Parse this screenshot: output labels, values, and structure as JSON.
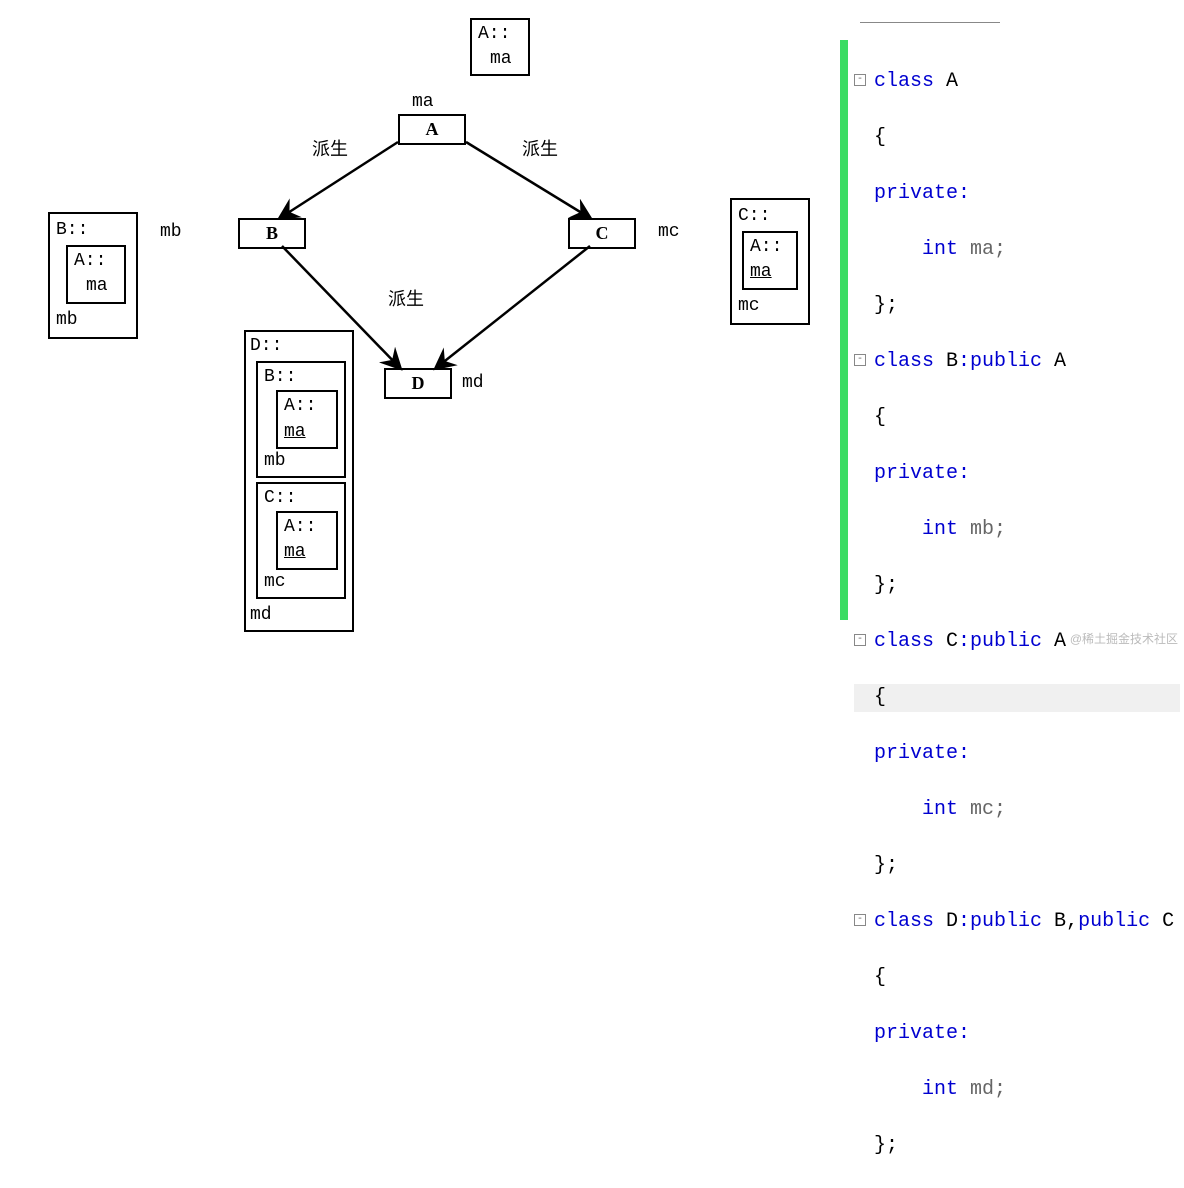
{
  "tiny_box": {
    "line1": "A::",
    "line2": "ma"
  },
  "node_a": "A",
  "node_b": "B",
  "node_c": "C",
  "node_d": "D",
  "label_ma_top": "ma",
  "label_mb": "mb",
  "label_mc": "mc",
  "label_md": "md",
  "label_derive_ab": "派生",
  "label_derive_ac": "派生",
  "label_derive_bd": "派生",
  "boxB": {
    "title": "B::",
    "inner": {
      "line1": "A::",
      "line2": "ma"
    },
    "tail": "mb"
  },
  "boxC": {
    "title": "C::",
    "inner": {
      "line1": "A::",
      "line2": "ma"
    },
    "tail": "mc"
  },
  "boxD": {
    "title": "D::",
    "blkB": {
      "title": "B::",
      "inner": {
        "line1": "A::",
        "line2": "ma"
      },
      "tail": "mb"
    },
    "blkC": {
      "title": "C::",
      "inner": {
        "line1": "A::",
        "line2": "ma"
      },
      "tail": "mc"
    },
    "tail": "md"
  },
  "code": {
    "l1a": "class ",
    "l1b": "A",
    "l2": "{",
    "l3": "private:",
    "l4a": "    int ",
    "l4b": "ma;",
    "l5": "};",
    "l6a": "class ",
    "l6b": "B",
    "l6c": ":public ",
    "l6d": "A",
    "l7": "{",
    "l8": "private:",
    "l9a": "    int ",
    "l9b": "mb;",
    "l10": "};",
    "l11a": "class ",
    "l11b": "C",
    "l11c": ":public ",
    "l11d": "A",
    "l12": "{",
    "l13": "private:",
    "l14a": "    int ",
    "l14b": "mc;",
    "l15": "};",
    "l16a": "class ",
    "l16b": "D",
    "l16c": ":public ",
    "l16d": "B",
    "l16e": ",",
    "l16f": "public ",
    "l16g": "C",
    "l17": "{",
    "l18": "private:",
    "l19a": "    int ",
    "l19b": "md;",
    "l20": "};"
  },
  "watermark": "@稀土掘金技术社区"
}
